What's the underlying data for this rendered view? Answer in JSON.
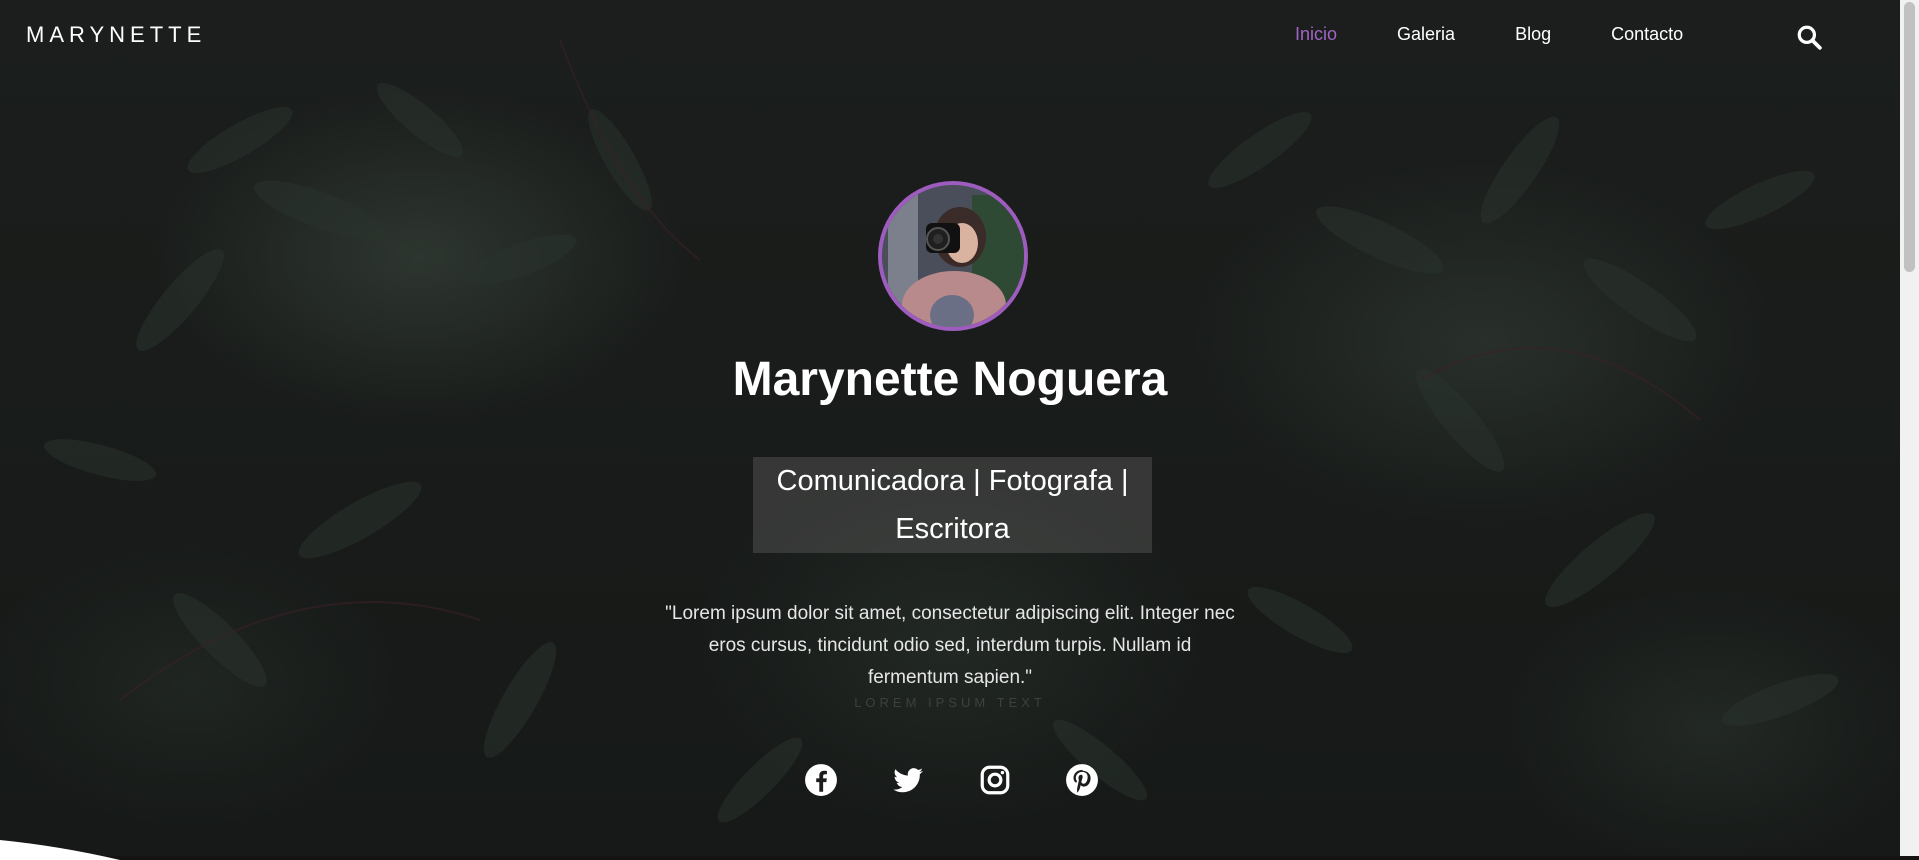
{
  "brand": {
    "logo": "MARYNETTE"
  },
  "nav": {
    "items": [
      {
        "label": "Inicio",
        "active": true
      },
      {
        "label": "Galeria",
        "active": false
      },
      {
        "label": "Blog",
        "active": false
      },
      {
        "label": "Contacto",
        "active": false
      }
    ],
    "search_icon": "search-icon"
  },
  "hero": {
    "avatar_icon": "profile-photo",
    "name": "Marynette Noguera",
    "tagline_line1": "Comunicadora | Fotografa |",
    "tagline_line2": "Escritora",
    "quote": "\"Lorem ipsum dolor sit amet, consectetur adipiscing elit. Integer nec eros cursus, tincidunt odio sed, interdum turpis. Nullam id fermentum sapien.\"",
    "ghost_text": "LOREM IPSUM TEXT"
  },
  "social": [
    {
      "icon": "facebook-icon"
    },
    {
      "icon": "twitter-icon"
    },
    {
      "icon": "instagram-icon"
    },
    {
      "icon": "pinterest-icon"
    }
  ],
  "colors": {
    "accent": "#a064c4",
    "avatar_border": "#9d5cbe",
    "background": "#161917"
  }
}
